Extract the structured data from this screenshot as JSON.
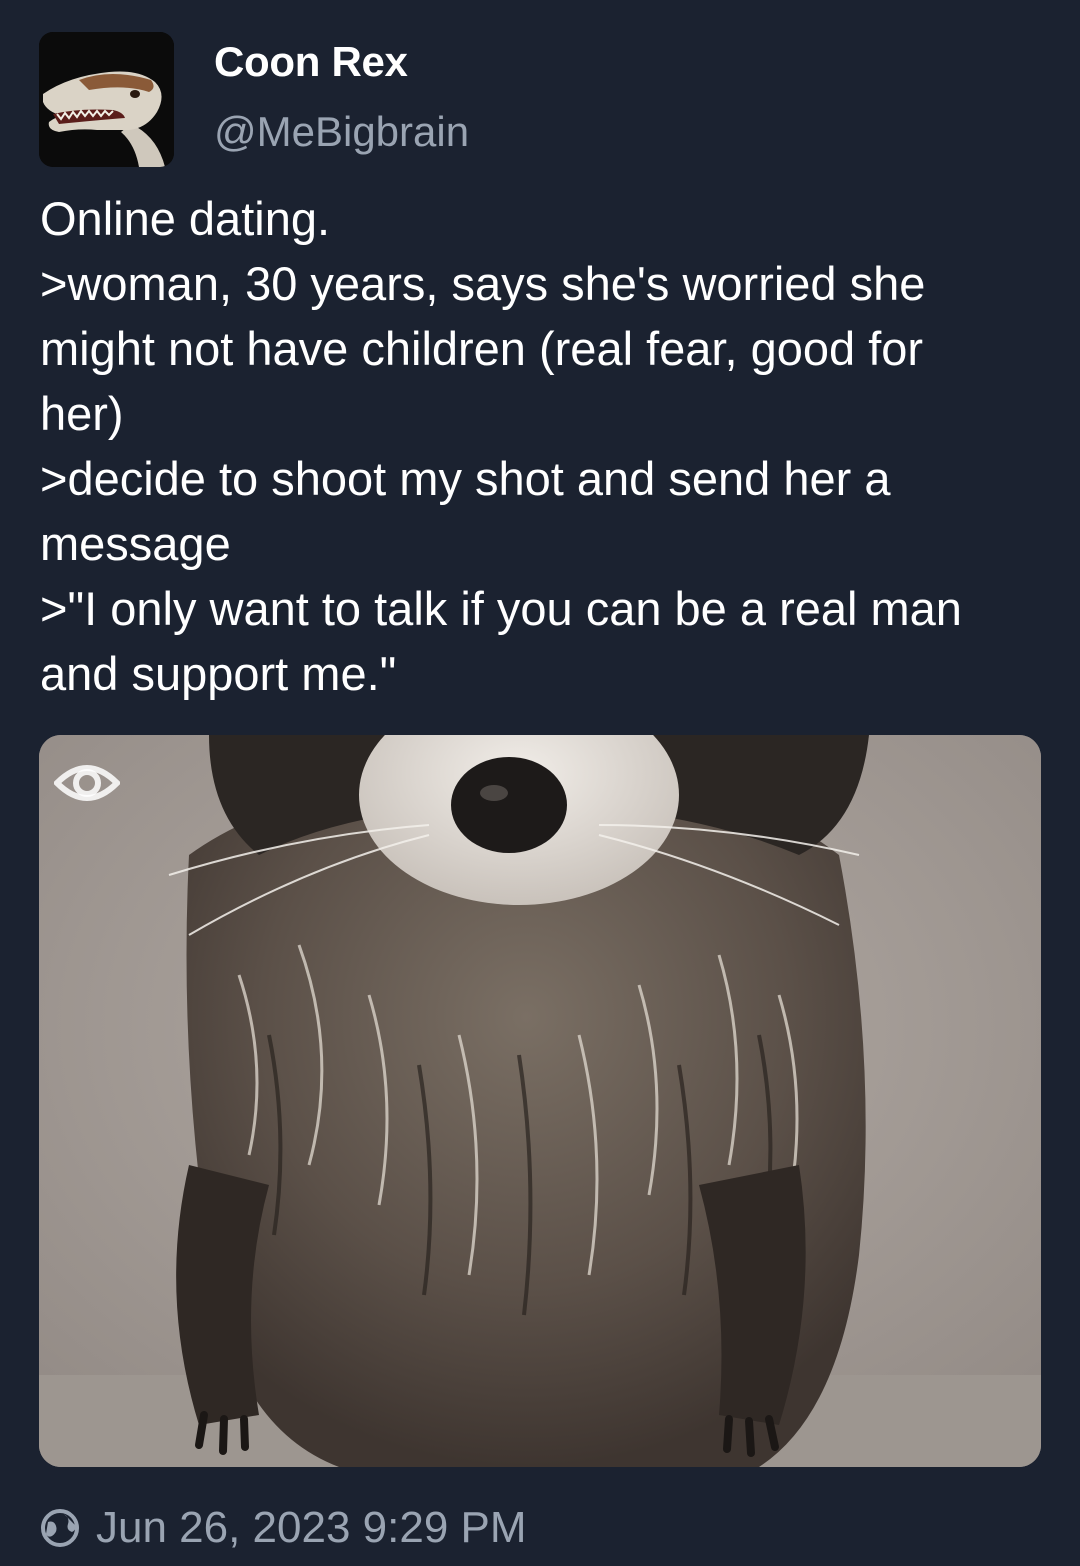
{
  "tweet": {
    "display_name": "Coon Rex",
    "handle": "@MeBigbrain",
    "text_lines": [
      "Online dating.",
      ">woman, 30 years, says she's worried she",
      "might not have children (real fear, good for",
      "her)",
      ">decide to shoot my shot and send her a",
      "message",
      ">\"I only want to talk if you can be a real man",
      "and support me.\""
    ],
    "timestamp": "Jun 26, 2023 9:29 PM"
  },
  "icons": {
    "avatar": "dinosaur-head-avatar",
    "media_overlay": "eye-icon",
    "visibility": "globe-icon"
  },
  "colors": {
    "background": "#1b2230",
    "text_primary": "#ffffff",
    "text_secondary": "#9aa4b2"
  }
}
